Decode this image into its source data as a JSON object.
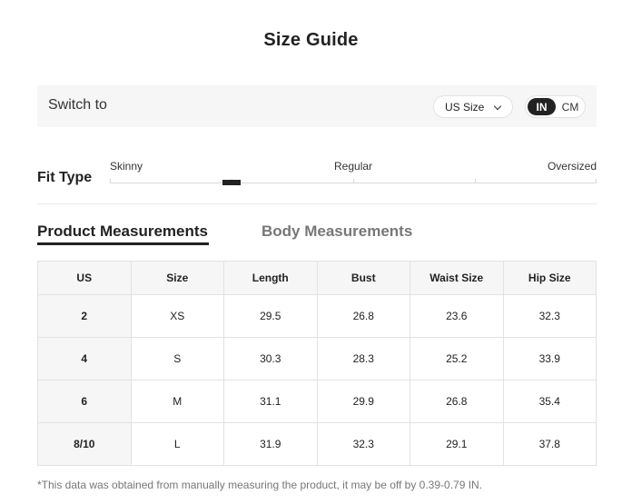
{
  "title": "Size Guide",
  "switch_bar": {
    "label": "Switch to",
    "size_select": "US Size",
    "units": {
      "in_label": "IN",
      "cm_label": "CM",
      "selected": "IN"
    }
  },
  "fit_type": {
    "label": "Fit Type",
    "scale_labels": [
      "Skinny",
      "Regular",
      "Oversized"
    ],
    "selected_position": 0.25
  },
  "tabs": [
    {
      "label": "Product Measurements",
      "active": true
    },
    {
      "label": "Body Measurements",
      "active": false
    }
  ],
  "table": {
    "headers": [
      "US",
      "Size",
      "Length",
      "Bust",
      "Waist Size",
      "Hip Size"
    ],
    "rows": [
      [
        "2",
        "XS",
        "29.5",
        "26.8",
        "23.6",
        "32.3"
      ],
      [
        "4",
        "S",
        "30.3",
        "28.3",
        "25.2",
        "33.9"
      ],
      [
        "6",
        "M",
        "31.1",
        "29.9",
        "26.8",
        "35.4"
      ],
      [
        "8/10",
        "L",
        "31.9",
        "32.3",
        "29.1",
        "37.8"
      ]
    ]
  },
  "note": "*This data was obtained from manually measuring the product, it may be off by 0.39-0.79 IN.",
  "colors": {
    "accent": "#222222",
    "panel_bg": "#f6f6f6",
    "border": "#e2e2e2",
    "muted_text": "#777777"
  }
}
